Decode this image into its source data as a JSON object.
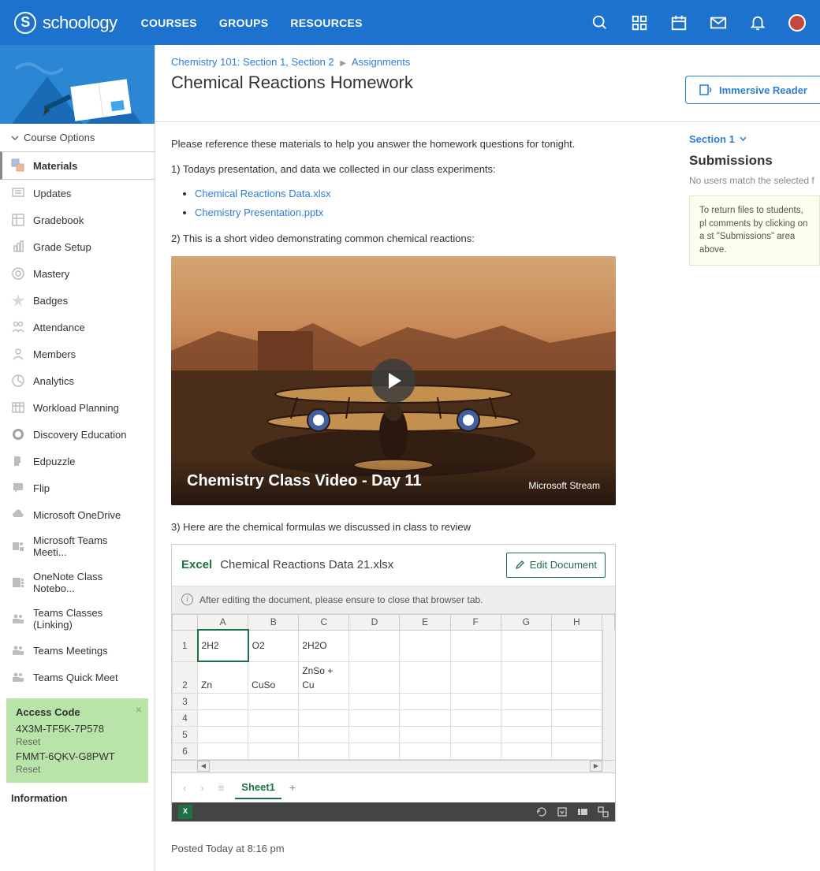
{
  "brand": "schoology",
  "topnav": [
    "COURSES",
    "GROUPS",
    "RESOURCES"
  ],
  "courseOptions": "Course Options",
  "sidenav": [
    "Materials",
    "Updates",
    "Gradebook",
    "Grade Setup",
    "Mastery",
    "Badges",
    "Attendance",
    "Members",
    "Analytics",
    "Workload Planning",
    "Discovery Education",
    "Edpuzzle",
    "Flip",
    "Microsoft OneDrive",
    "Microsoft Teams Meeti...",
    "OneNote Class Notebo...",
    "Teams Classes (Linking)",
    "Teams Meetings",
    "Teams Quick Meet"
  ],
  "access": {
    "title": "Access Code",
    "code1": "4X3M-TF5K-7P578",
    "code2": "FMMT-6QKV-G8PWT",
    "reset": "Reset"
  },
  "infoHeader": "Information",
  "breadcrumb": {
    "course": "Chemistry 101: Section 1, Section 2",
    "section": "Assignments"
  },
  "pageTitle": "Chemical Reactions Homework",
  "immersive": "Immersive Reader",
  "body": {
    "intro": "Please reference these materials to help you answer the homework questions for tonight.",
    "p1": "1) Todays presentation, and data we collected in our class experiments:",
    "link1": "Chemical Reactions Data.xlsx",
    "link2": "Chemistry Presentation.pptx",
    "p2": "2) This is a short video demonstrating common chemical reactions:",
    "videoTitle": "Chemistry Class Video - Day 11",
    "videoSource": "Microsoft Stream",
    "p3": "3) Here are the chemical formulas we discussed in class to review",
    "excelApp": "Excel",
    "excelFile": "Chemical Reactions Data 21.xlsx",
    "editDoc": "Edit Document",
    "editNote": "After editing the document, please ensure to close that browser tab.",
    "cols": [
      "A",
      "B",
      "C",
      "D",
      "E",
      "F",
      "G",
      "H"
    ],
    "rows": [
      {
        "n": "1",
        "cells": [
          "2H2",
          "O2",
          "2H2O",
          "",
          "",
          "",
          "",
          ""
        ]
      },
      {
        "n": "2",
        "cells": [
          "Zn",
          "CuSo",
          "ZnSo + Cu",
          "",
          "",
          "",
          "",
          ""
        ]
      },
      {
        "n": "3",
        "cells": [
          "",
          "",
          "",
          "",
          "",
          "",
          "",
          ""
        ]
      },
      {
        "n": "4",
        "cells": [
          "",
          "",
          "",
          "",
          "",
          "",
          "",
          ""
        ]
      },
      {
        "n": "5",
        "cells": [
          "",
          "",
          "",
          "",
          "",
          "",
          "",
          ""
        ]
      },
      {
        "n": "6",
        "cells": [
          "",
          "",
          "",
          "",
          "",
          "",
          "",
          ""
        ]
      }
    ],
    "sheetTab": "Sheet1",
    "posted": "Posted Today at 8:16 pm"
  },
  "right": {
    "section": "Section 1",
    "submTitle": "Submissions",
    "submEmpty": "No users match the selected f",
    "tip": "To return files to students, pl comments by clicking on a st \"Submissions\" area above."
  }
}
